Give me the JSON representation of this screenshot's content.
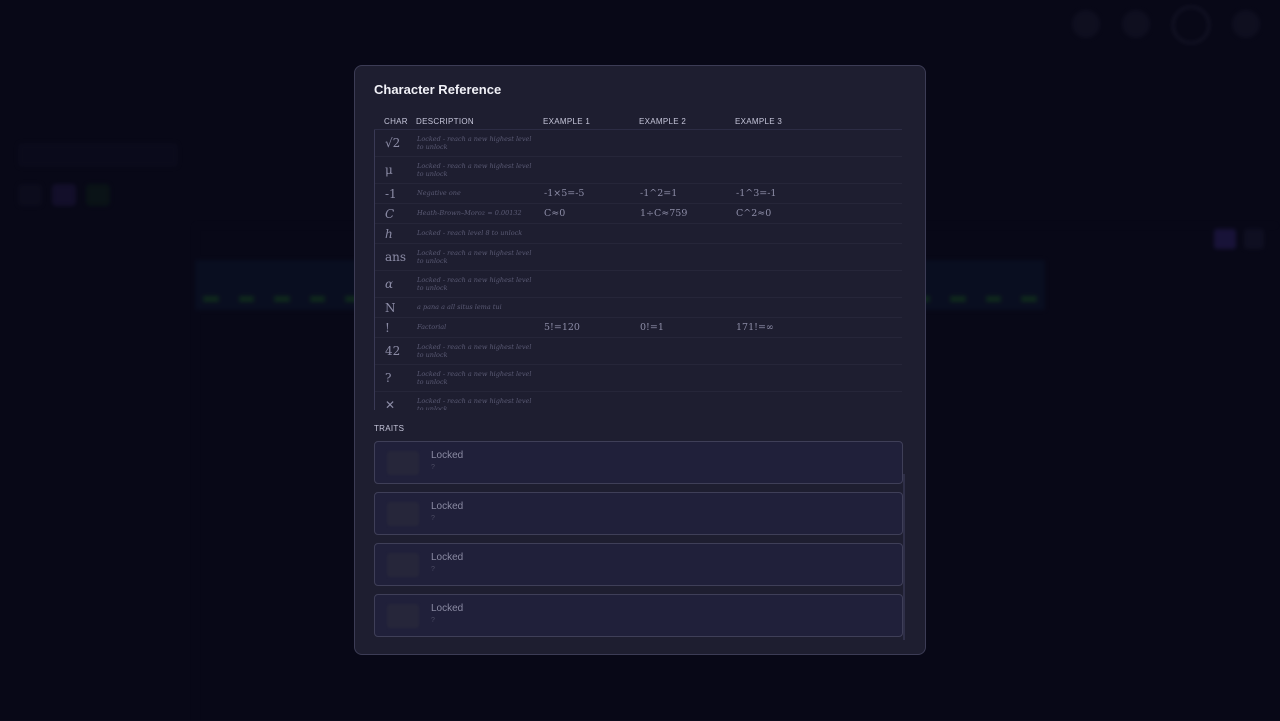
{
  "modal": {
    "title": "Character Reference",
    "columns": [
      "CHAR",
      "DESCRIPTION",
      "EXAMPLE 1",
      "EXAMPLE 2",
      "EXAMPLE 3"
    ],
    "rows": [
      {
        "char": "√2",
        "italic": false,
        "desc": "Locked - reach a new highest level to unlock",
        "ex1": "",
        "ex2": "",
        "ex3": ""
      },
      {
        "char": "μ",
        "italic": false,
        "desc": "Locked - reach a new highest level to unlock",
        "ex1": "",
        "ex2": "",
        "ex3": ""
      },
      {
        "char": "-1",
        "italic": false,
        "desc": "Negative one",
        "ex1": "-1×5=-5",
        "ex2": "-1^2=1",
        "ex3": "-1^3=-1"
      },
      {
        "char": "C",
        "italic": true,
        "desc": "Heath-Brown–Moroz ≈ 0.00132",
        "ex1": "C≈0",
        "ex2": "1÷C≈759",
        "ex3": "C^2≈0"
      },
      {
        "char": "h",
        "italic": true,
        "desc": "Locked - reach level 8 to unlock",
        "ex1": "",
        "ex2": "",
        "ex3": ""
      },
      {
        "char": "ans",
        "italic": false,
        "desc": "Locked - reach a new highest level to unlock",
        "ex1": "",
        "ex2": "",
        "ex3": ""
      },
      {
        "char": "α",
        "italic": true,
        "desc": "Locked - reach a new highest level to unlock",
        "ex1": "",
        "ex2": "",
        "ex3": ""
      },
      {
        "char": "N",
        "italic": false,
        "desc": "a pana a all situs lema tui",
        "ex1": "",
        "ex2": "",
        "ex3": ""
      },
      {
        "char": "!",
        "italic": false,
        "desc": "Factorial",
        "ex1": "5!=120",
        "ex2": "0!=1",
        "ex3": "171!=∞"
      },
      {
        "char": "42",
        "italic": false,
        "desc": "Locked - reach a new highest level to unlock",
        "ex1": "",
        "ex2": "",
        "ex3": ""
      },
      {
        "char": "?",
        "italic": false,
        "desc": "Locked - reach a new highest level to unlock",
        "ex1": "",
        "ex2": "",
        "ex3": ""
      },
      {
        "char": "✕",
        "italic": false,
        "desc": "Locked - reach a new highest level to unlock",
        "ex1": "",
        "ex2": "",
        "ex3": ""
      }
    ],
    "traits_label": "TRAITS",
    "traits": [
      {
        "name": "Locked",
        "desc": "?"
      },
      {
        "name": "Locked",
        "desc": "?"
      },
      {
        "name": "Locked",
        "desc": "?"
      },
      {
        "name": "Locked",
        "desc": "?"
      }
    ]
  },
  "colors": {
    "background": "#0b0b1c",
    "modal_bg": "#1e1e30",
    "accent_purple": "#3a2a7a",
    "accent_green": "#1f6a2a"
  }
}
